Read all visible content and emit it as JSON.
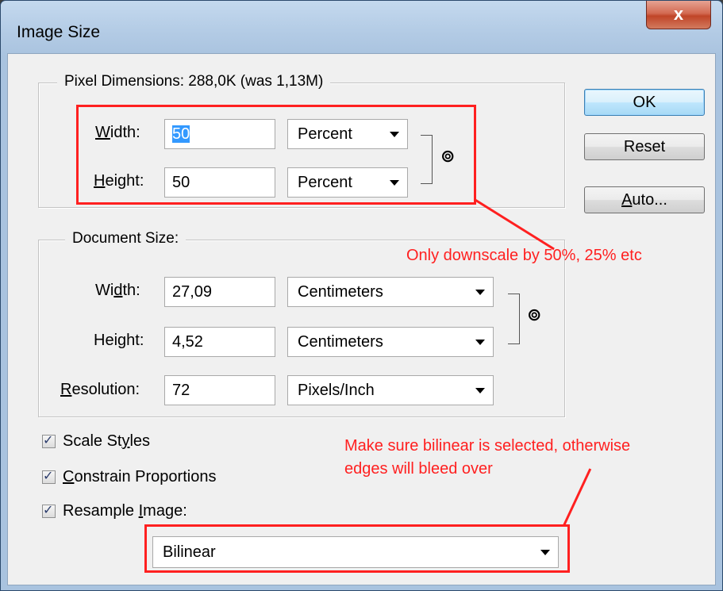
{
  "window": {
    "title": "Image Size",
    "close_label": "x"
  },
  "pixel_dimensions": {
    "legend": "Pixel Dimensions:  288,0K (was 1,13M)",
    "width": {
      "label_pre": "",
      "label_u": "W",
      "label_post": "idth:",
      "value": "50",
      "unit": "Percent"
    },
    "height": {
      "label_pre": "",
      "label_u": "H",
      "label_post": "eight:",
      "value": "50",
      "unit": "Percent"
    }
  },
  "document_size": {
    "legend": "Document Size:",
    "width": {
      "label_pre": "Wi",
      "label_u": "d",
      "label_post": "th:",
      "value": "27,09",
      "unit": "Centimeters"
    },
    "height": {
      "label_pre": "Hei",
      "label_u": "g",
      "label_post": "ht:",
      "value": "4,52",
      "unit": "Centimeters"
    },
    "resolution": {
      "label_pre": "",
      "label_u": "R",
      "label_post": "esolution:",
      "value": "72",
      "unit": "Pixels/Inch"
    }
  },
  "buttons": {
    "ok": "OK",
    "reset": "Reset",
    "auto_pre": "",
    "auto_u": "A",
    "auto_post": "uto..."
  },
  "options": {
    "scale_styles": {
      "pre": "Scale St",
      "u": "y",
      "post": "les",
      "checked": true
    },
    "constrain": {
      "pre": "",
      "u": "C",
      "post": "onstrain Proportions",
      "checked": true
    },
    "resample": {
      "pre": "Resample ",
      "u": "I",
      "post": "mage:",
      "checked": true
    },
    "method": "Bilinear"
  },
  "annotations": {
    "downscale": "Only downscale by 50%, 25% etc",
    "bilinear_line1": "Make sure bilinear is selected, otherwise",
    "bilinear_line2": "edges will bleed over"
  },
  "icons": {
    "link": "link-chain-icon",
    "check": "checkmark-icon",
    "arrow": "dropdown-arrow-icon"
  },
  "colors": {
    "annotation": "#ff2020",
    "selection": "#3399ff"
  }
}
